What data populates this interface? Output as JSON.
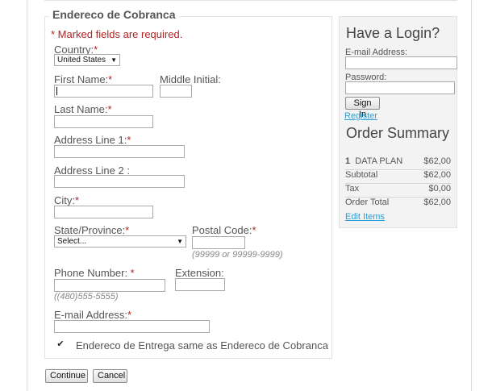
{
  "billing": {
    "legend": "Endereco de Cobranca",
    "required_note": "* Marked fields are required.",
    "country_label": "Country:",
    "country_value": "United States",
    "first_name_label": "First Name:",
    "middle_initial_label": "Middle Initial:",
    "last_name_label": "Last Name:",
    "address1_label": "Address Line 1:",
    "address2_label": "Address Line 2 :",
    "city_label": "City:",
    "state_label": "State/Province:",
    "state_value": "Select...",
    "postal_label": "Postal Code:",
    "postal_hint": "(99999 or 99999-9999)",
    "phone_label": "Phone Number: ",
    "extension_label": "Extension:",
    "phone_hint": "((480)555-5555)",
    "email_label": "E-mail Address:",
    "same_address_label": "Endereco de Entrega same as Endereco de Cobranca",
    "same_address_checked": true,
    "required_mark": "*"
  },
  "login": {
    "heading": "Have a Login?",
    "email_label": "E-mail Address:",
    "password_label": "Password:",
    "sign_in_label": "Sign In",
    "register_link": "Register"
  },
  "summary": {
    "heading": "Order Summary",
    "item_qty": "1",
    "item_name": "DATA PLAN",
    "item_price": "$62,00",
    "subtotal_label": "Subtotal",
    "subtotal_value": "$62,00",
    "tax_label": "Tax",
    "tax_value": "$0,00",
    "total_label": "Order Total",
    "total_value": "$62,00",
    "edit_items_link": "Edit Items"
  },
  "actions": {
    "continue_label": "Continue",
    "cancel_label": "Cancel"
  },
  "colors": {
    "required": "#b22222",
    "link": "#2a9fd6",
    "panel_bg": "#f3f3f3"
  }
}
